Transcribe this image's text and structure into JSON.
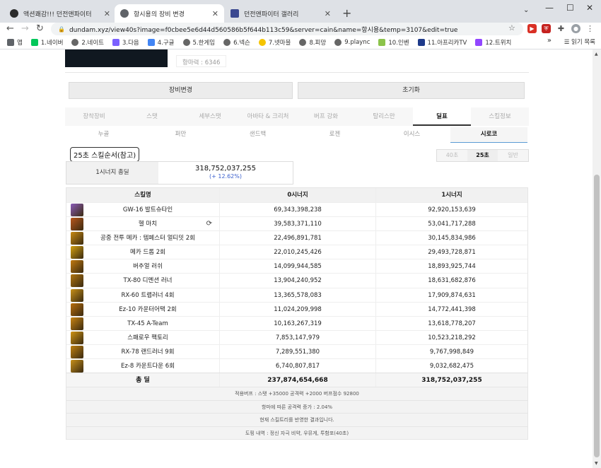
{
  "browser": {
    "tabs": [
      {
        "title": "액션쾌감!!! 던전앤파이터",
        "favicon_color": "#2b2b2b"
      },
      {
        "title": "항시용의 장비 변경",
        "favicon_color": "#5f6368"
      },
      {
        "title": "던전앤파이터 갤러리",
        "favicon_color": "#3b4890"
      }
    ],
    "url": "dundam.xyz/view40s?image=f0cbee5e6d44d560586b5f644b113c59&server=cain&name=항시용&temp=3107&edit=true",
    "bookmarks": [
      "앱",
      "1.네이버",
      "2.네이트",
      "3.다음",
      "4.구글",
      "5.한게임",
      "6.넥슨",
      "7.넷마블",
      "8.피망",
      "9.plaync",
      "10.인벤",
      "11.아프리카TV",
      "12.트위치"
    ],
    "reading_list": "읽기 목록"
  },
  "profile": {
    "name_box": "항마력 : 6346"
  },
  "buttons": {
    "equip_change": "장비변경",
    "reset": "초기화"
  },
  "main_tabs": [
    "장착장비",
    "스탯",
    "세부스탯",
    "아바타 & 크리처",
    "버프 강화",
    "탈리스만",
    "딜표",
    "스킬정보"
  ],
  "main_tab_active": 6,
  "sub_tabs": [
    "누골",
    "퍼만",
    "샌드백",
    "로젠",
    "이시스",
    "시로코"
  ],
  "sub_tab_active": 5,
  "rotation_label": "25초 스킬순서(참고)",
  "time_options": [
    "40초",
    "25초",
    "일반"
  ],
  "time_active": 1,
  "synergy": {
    "label": "1시너지 총딜",
    "value": "318,752,037,255",
    "diff": "(+ 12.62%)"
  },
  "table": {
    "headers": [
      "스킬명",
      "0시너지",
      "1시너지"
    ],
    "rows": [
      {
        "name": "GW-16 발트슈타인",
        "s0": "69,343,398,238",
        "s1": "92,920,153,639",
        "icon_color": "#8a5bb8"
      },
      {
        "name": "헬 마치",
        "s0": "39,583,371,110",
        "s1": "53,041,717,288",
        "icon_color": "#b8561c"
      },
      {
        "name": "공중 전투 메카 : 템페스터 얼티밋 2회",
        "s0": "22,496,891,781",
        "s1": "30,145,834,986",
        "icon_color": "#c98a12"
      },
      {
        "name": "메카 드롭 2회",
        "s0": "22,010,245,426",
        "s1": "29,493,728,871",
        "icon_color": "#d4a010"
      },
      {
        "name": "버추얼 러쉬",
        "s0": "14,099,944,585",
        "s1": "18,893,925,744",
        "icon_color": "#c27a10"
      },
      {
        "name": "TX-80 디멘션 러너",
        "s0": "13,904,240,952",
        "s1": "18,631,682,876",
        "icon_color": "#b07410"
      },
      {
        "name": "RX-60 트랩러너 4회",
        "s0": "13,365,578,083",
        "s1": "17,909,874,631",
        "icon_color": "#c89018"
      },
      {
        "name": "Ez-10 카운터어택 2회",
        "s0": "11,024,209,998",
        "s1": "14,772,441,398",
        "icon_color": "#b86e0c"
      },
      {
        "name": "TX-45 A-Team",
        "s0": "10,163,267,319",
        "s1": "13,618,778,207",
        "icon_color": "#c98412"
      },
      {
        "name": "스패로우 팩토리",
        "s0": "7,853,147,979",
        "s1": "10,523,218,292",
        "icon_color": "#d09414"
      },
      {
        "name": "RX-78 랜드러너 9회",
        "s0": "7,289,551,380",
        "s1": "9,767,998,849",
        "icon_color": "#bf8010"
      },
      {
        "name": "Ez-8 카운트다운 6회",
        "s0": "6,740,807,817",
        "s1": "9,032,682,475",
        "icon_color": "#c8901a"
      }
    ],
    "total": {
      "label": "총 딜",
      "s0": "237,874,654,668",
      "s1": "318,752,037,255"
    },
    "notes": [
      "적용버프 : 스탯 +35000 공격력 +2000 버프점수 92800",
      "항마에 따른 공격력 증가 : 2.04%",
      "현재 스킬트리를 반영한 결과입니다.",
      "도핑 내역 : 정신 자극 비약, 우뮤게, 투함포(40초)"
    ]
  }
}
